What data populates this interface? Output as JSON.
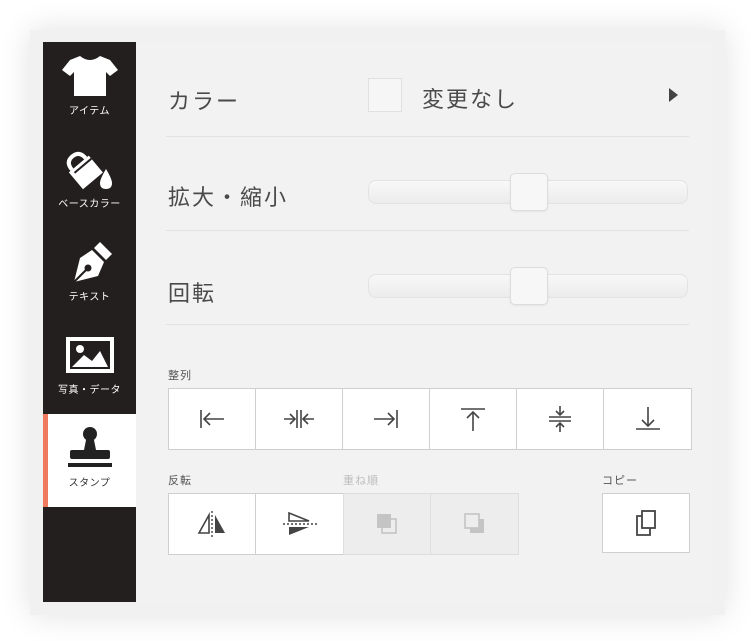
{
  "sidebar": {
    "items": [
      {
        "label": "アイテム",
        "icon": "tshirt-icon"
      },
      {
        "label": "ベースカラー",
        "icon": "paint-bucket-icon"
      },
      {
        "label": "テキスト",
        "icon": "pen-nib-icon"
      },
      {
        "label": "写真・データ",
        "icon": "image-icon"
      },
      {
        "label": "スタンプ",
        "icon": "stamp-icon",
        "active": true
      }
    ],
    "active_accent": "#ef7a5e",
    "background": "#231f1f"
  },
  "color_row": {
    "label": "カラー",
    "value": "変更なし"
  },
  "scale_row": {
    "label": "拡大・縮小",
    "level": 0.5
  },
  "rotate_row": {
    "label": "回転",
    "level": 0.5
  },
  "align": {
    "label": "整列",
    "buttons": [
      "align-left-icon",
      "align-center-h-icon",
      "align-right-icon",
      "align-top-icon",
      "align-center-v-icon",
      "align-bottom-icon"
    ]
  },
  "flip": {
    "label": "反転",
    "buttons": [
      "flip-horizontal-icon",
      "flip-vertical-icon"
    ]
  },
  "order": {
    "label": "重ね順",
    "disabled": true,
    "buttons": [
      "bring-forward-icon",
      "send-backward-icon"
    ]
  },
  "copy": {
    "label": "コピー",
    "icon": "copy-icon"
  }
}
